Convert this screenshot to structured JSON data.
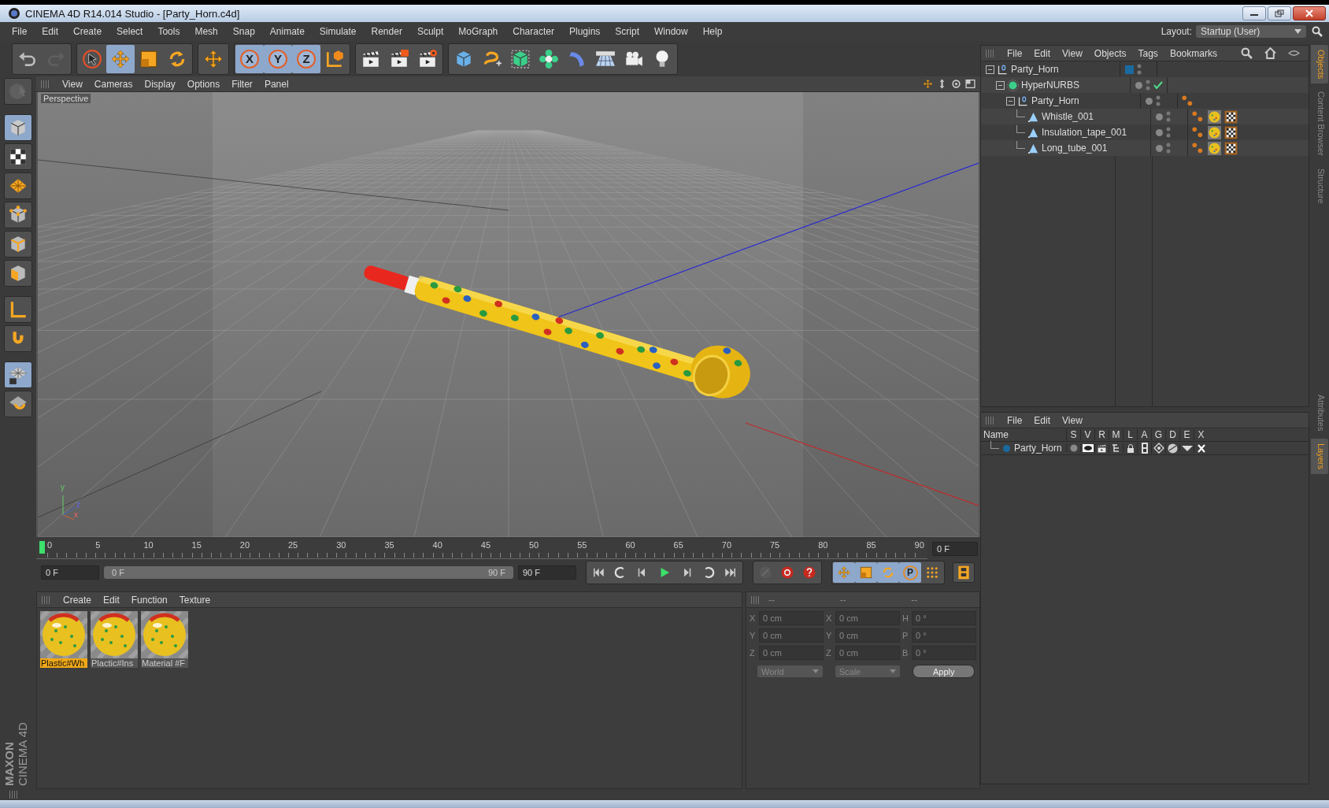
{
  "window": {
    "title": "CINEMA 4D R14.014 Studio - [Party_Horn.c4d]"
  },
  "menu": [
    "File",
    "Edit",
    "Create",
    "Select",
    "Tools",
    "Mesh",
    "Snap",
    "Animate",
    "Simulate",
    "Render",
    "Sculpt",
    "MoGraph",
    "Character",
    "Plugins",
    "Script",
    "Window",
    "Help"
  ],
  "layout": {
    "label": "Layout:",
    "value": "Startup (User)"
  },
  "toolbar": [
    {
      "tools": [
        {
          "kind": "undo",
          "selected": false,
          "disabled": false
        },
        {
          "kind": "redo",
          "selected": false,
          "disabled": true
        }
      ]
    },
    {
      "tools": [
        {
          "kind": "live-select",
          "selected": false,
          "disabled": false
        },
        {
          "kind": "move",
          "selected": true,
          "disabled": false
        },
        {
          "kind": "scale",
          "selected": false,
          "disabled": false
        },
        {
          "kind": "rotate",
          "selected": false,
          "disabled": false
        }
      ]
    },
    {
      "tools": [
        {
          "kind": "add-move",
          "selected": false,
          "disabled": false
        }
      ]
    },
    {
      "tools": [
        {
          "kind": "axis-lock",
          "label": "X",
          "selected": true,
          "disabled": false
        },
        {
          "kind": "axis-lock",
          "label": "Y",
          "selected": true,
          "disabled": false
        },
        {
          "kind": "axis-lock",
          "label": "Z",
          "selected": true,
          "disabled": false
        },
        {
          "kind": "coord",
          "selected": false,
          "disabled": false
        }
      ]
    },
    {
      "tools": [
        {
          "kind": "render-view",
          "selected": false,
          "disabled": false
        },
        {
          "kind": "render-viewer",
          "selected": false,
          "disabled": false
        },
        {
          "kind": "render-settings",
          "selected": false,
          "disabled": false
        }
      ]
    },
    {
      "tools": [
        {
          "kind": "cube",
          "selected": false,
          "disabled": false
        },
        {
          "kind": "spline",
          "selected": false,
          "disabled": false
        },
        {
          "kind": "subdiv",
          "selected": false,
          "disabled": false
        },
        {
          "kind": "array",
          "selected": false,
          "disabled": false
        },
        {
          "kind": "deformer",
          "selected": false,
          "disabled": false
        },
        {
          "kind": "floor",
          "selected": false,
          "disabled": false
        },
        {
          "kind": "camera",
          "selected": false,
          "disabled": false
        },
        {
          "kind": "light",
          "selected": false,
          "disabled": false
        }
      ]
    }
  ],
  "left_tools": [
    {
      "kind": "tweak",
      "selected": false,
      "disabled": true
    },
    {
      "kind": "model",
      "selected": true,
      "disabled": false
    },
    {
      "kind": "texture",
      "selected": false,
      "disabled": false
    },
    {
      "kind": "workplane",
      "selected": false,
      "disabled": false
    },
    {
      "kind": "points",
      "selected": false,
      "disabled": false
    },
    {
      "kind": "edges",
      "selected": false,
      "disabled": false
    },
    {
      "kind": "polygons",
      "selected": false,
      "disabled": false
    },
    {
      "kind": "axis",
      "selected": false,
      "disabled": false
    },
    {
      "kind": "magnet",
      "selected": false,
      "disabled": false
    },
    {
      "kind": "grid-lock",
      "selected": true,
      "disabled": false
    },
    {
      "kind": "snap",
      "selected": false,
      "disabled": false
    }
  ],
  "logo": [
    "MAXON",
    "CINEMA 4D"
  ],
  "viewport": {
    "menu": [
      "View",
      "Cameras",
      "Display",
      "Options",
      "Filter",
      "Panel"
    ],
    "camera_label": "Perspective",
    "axis_labels": [
      "y",
      "z",
      "x"
    ]
  },
  "timeline": {
    "ticks": [
      "0",
      "5",
      "10",
      "15",
      "20",
      "25",
      "30",
      "35",
      "40",
      "45",
      "50",
      "55",
      "60",
      "65",
      "70",
      "75",
      "80",
      "85",
      "90"
    ],
    "playhead": {
      "level": 0
    },
    "current_frame": "0 F",
    "start_field": "0 F",
    "range": {
      "start": "0 F",
      "end": "90 F",
      "level": 1
    },
    "end_field": "90 F",
    "transport": [
      {
        "kind": "first"
      },
      {
        "kind": "prev-key"
      },
      {
        "kind": "prev"
      },
      {
        "kind": "play"
      },
      {
        "kind": "next"
      },
      {
        "kind": "next-key"
      },
      {
        "kind": "last"
      }
    ],
    "keys": [
      {
        "kind": "motion",
        "selected": false,
        "disabled": true
      },
      {
        "kind": "record",
        "selected": false,
        "disabled": false
      },
      {
        "kind": "autokey",
        "selected": false,
        "disabled": false
      }
    ],
    "key_tracks": [
      {
        "kind": "move",
        "selected": true
      },
      {
        "kind": "scale",
        "selected": true
      },
      {
        "kind": "rotate",
        "selected": true
      },
      {
        "kind": "param",
        "label": "P",
        "selected": true
      },
      {
        "kind": "pla",
        "selected": false
      }
    ]
  },
  "materials": {
    "menu": [
      "Create",
      "Edit",
      "Function",
      "Texture"
    ],
    "items": [
      {
        "name": "Plastic#Wh",
        "selected": true
      },
      {
        "name": "Plactic#Ins",
        "selected": false
      },
      {
        "name": "Material #F",
        "selected": false
      }
    ]
  },
  "coordinates": {
    "disabled": true,
    "headers": [
      "--",
      "--",
      "--"
    ],
    "rows": [
      {
        "cells": [
          {
            "label": "X",
            "value": "0 cm"
          },
          {
            "label": "X",
            "value": "0 cm"
          },
          {
            "label": "H",
            "value": "0 °"
          }
        ]
      },
      {
        "cells": [
          {
            "label": "Y",
            "value": "0 cm"
          },
          {
            "label": "Y",
            "value": "0 cm"
          },
          {
            "label": "P",
            "value": "0 °"
          }
        ]
      },
      {
        "cells": [
          {
            "label": "Z",
            "value": "0 cm"
          },
          {
            "label": "Z",
            "value": "0 cm"
          },
          {
            "label": "B",
            "value": "0 °"
          }
        ]
      }
    ],
    "dropdowns": [
      "World",
      "Scale"
    ],
    "apply": "Apply"
  },
  "objects": {
    "menu": [
      "File",
      "Edit",
      "View",
      "Objects",
      "Tags",
      "Bookmarks"
    ],
    "tree": [
      {
        "name": "Party_Horn",
        "kind": "null",
        "color": "#1a6aa0",
        "expanded": true,
        "checked": false,
        "phong_tag": false,
        "material_tag": false,
        "children": [
          {
            "name": "HyperNURBS",
            "kind": "hypernurbs",
            "expanded": true,
            "checked": true,
            "phong_tag": false,
            "material_tag": false,
            "children": [
              {
                "name": "Party_Horn",
                "kind": "null",
                "expanded": true,
                "checked": false,
                "phong_tag": true,
                "material_tag": false,
                "children": [
                  {
                    "name": "Whistle_001",
                    "kind": "polygon",
                    "checked": false,
                    "phong_tag": true,
                    "material_tag": true
                  },
                  {
                    "name": "Insulation_tape_001",
                    "kind": "polygon",
                    "checked": false,
                    "phong_tag": true,
                    "material_tag": true
                  },
                  {
                    "name": "Long_tube_001",
                    "kind": "polygon",
                    "checked": false,
                    "phong_tag": true,
                    "material_tag": true
                  }
                ]
              }
            ]
          }
        ]
      }
    ]
  },
  "layers": {
    "menu": [
      "File",
      "Edit",
      "View"
    ],
    "columns": [
      "Name",
      "S",
      "V",
      "R",
      "M",
      "L",
      "A",
      "G",
      "D",
      "E",
      "X"
    ],
    "rows": [
      {
        "name": "Party_Horn",
        "color": "#1a6aa0"
      }
    ]
  },
  "side_tabs_top": [
    {
      "label": "Objects",
      "selected": true
    },
    {
      "label": "Content Browser",
      "selected": false
    },
    {
      "label": "Structure",
      "selected": false
    }
  ],
  "side_tabs_bottom": [
    {
      "label": "Attributes",
      "selected": false
    },
    {
      "label": "Layers",
      "selected": true
    }
  ]
}
